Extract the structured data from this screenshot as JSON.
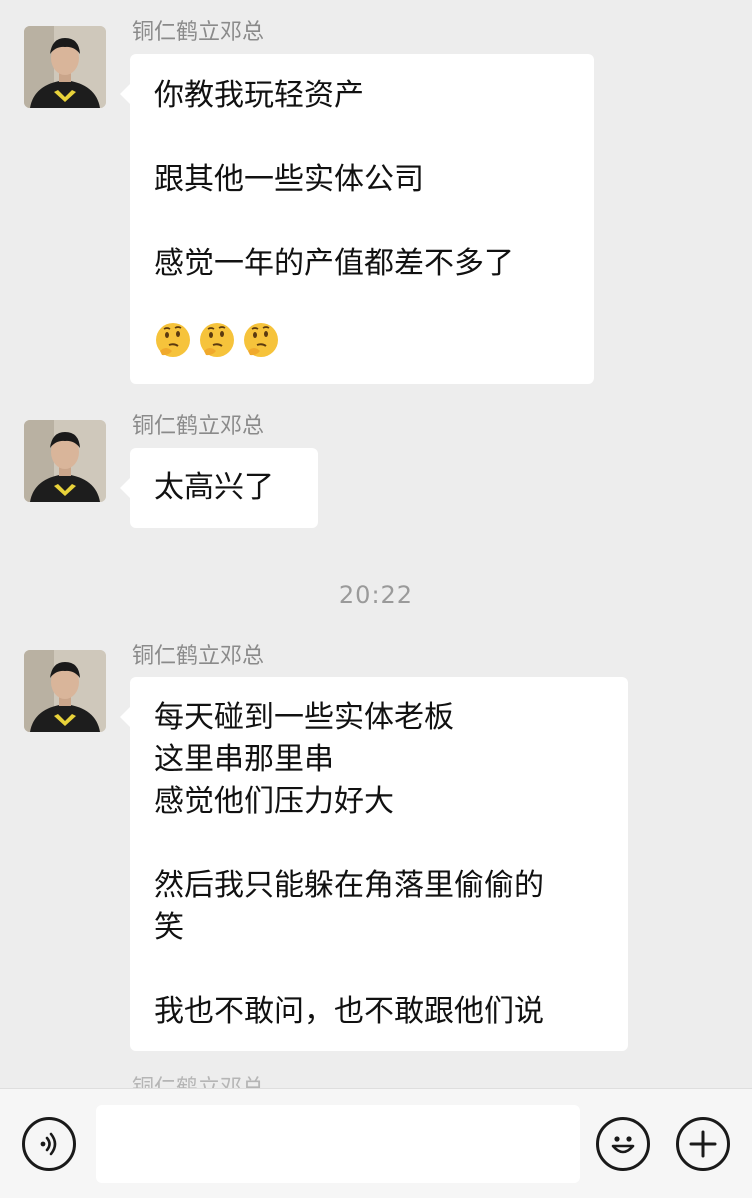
{
  "messages": [
    {
      "sender": "铜仁鹤立邓总",
      "lines": [
        "你教我玩轻资产",
        "跟其他一些实体公司",
        "感觉一年的产值都差不多了"
      ],
      "emojis": [
        "thinking-face-emoji",
        "thinking-face-emoji",
        "thinking-face-emoji"
      ]
    },
    {
      "sender": "铜仁鹤立邓总",
      "lines": [
        "太高兴了"
      ]
    },
    {
      "sender": "铜仁鹤立邓总",
      "lines": [
        "每天碰到一些实体老板",
        "这里串那里串",
        "感觉他们压力好大",
        "然后我只能躲在角落里偷偷的",
        "笑",
        "我也不敢问，也不敢跟他们说"
      ]
    }
  ],
  "timestamp": "20:22",
  "input_bar": {
    "icons": [
      "voice-icon",
      "emoji-icon",
      "plus-icon"
    ],
    "input_value": ""
  },
  "colors": {
    "background": "#ededed",
    "bubble": "#ffffff",
    "sender_name": "#8a8a8a",
    "timestamp": "#9a9a9a"
  }
}
